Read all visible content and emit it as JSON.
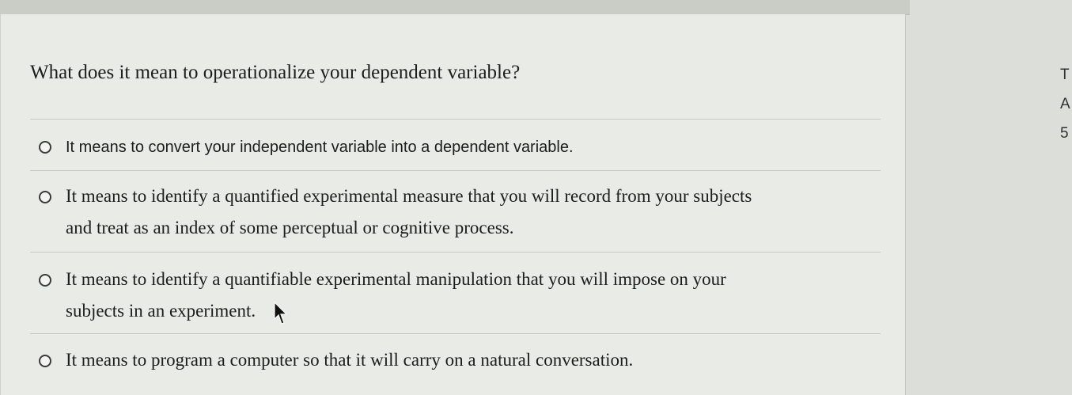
{
  "question": {
    "text": "What does it mean to operationalize your dependent variable?"
  },
  "options": [
    {
      "label": "It means to convert your independent variable into a dependent variable."
    },
    {
      "line1": "It means to identify a quantified experimental measure that you will record from your subjects",
      "line2": "and treat as an index of some perceptual or cognitive process."
    },
    {
      "line1": "It means to identify a quantifiable experimental manipulation that you will impose on your",
      "line2": "subjects in an experiment."
    },
    {
      "label": "It means to program a computer so that it will carry on a natural conversation."
    }
  ],
  "side_panel": {
    "letters": [
      "T",
      "A",
      "5"
    ]
  }
}
